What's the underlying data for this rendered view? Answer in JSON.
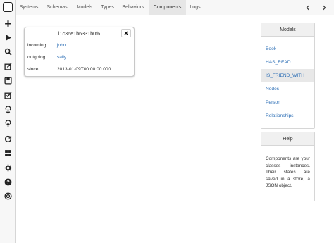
{
  "topnav": {
    "tabs": [
      {
        "label": "Systems",
        "active": false
      },
      {
        "label": "Schemas",
        "active": false
      },
      {
        "label": "Models",
        "active": false
      },
      {
        "label": "Types",
        "active": false
      },
      {
        "label": "Behaviors",
        "active": false
      },
      {
        "label": "Components",
        "active": true
      },
      {
        "label": "Logs",
        "active": false
      }
    ],
    "prev_icon": "chevron-left-icon",
    "next_icon": "chevron-right-icon"
  },
  "leftbar": {
    "icons": [
      "plus-icon",
      "play-icon",
      "search-icon",
      "edit-icon",
      "save-icon",
      "checklist-icon",
      "download-icon",
      "upload-icon",
      "refresh-icon",
      "grid-icon",
      "gear-icon",
      "help-icon",
      "info-icon"
    ]
  },
  "component": {
    "title": "i1c36e1b6331b0f6",
    "close_icon": "close-icon",
    "rows": [
      {
        "label": "incoming",
        "value": "john",
        "link": true
      },
      {
        "label": "outgoing",
        "value": "sally",
        "link": true
      },
      {
        "label": "since",
        "value": "2013-01-09T00:00:00.000 ...",
        "link": false
      }
    ]
  },
  "models_panel": {
    "title": "Models",
    "items": [
      {
        "label": "Book",
        "selected": false
      },
      {
        "label": "HAS_READ",
        "selected": false
      },
      {
        "label": "IS_FRIEND_WITH",
        "selected": true
      },
      {
        "label": "Nodes",
        "selected": false
      },
      {
        "label": "Person",
        "selected": false
      },
      {
        "label": "Relationships",
        "selected": false
      }
    ]
  },
  "help_panel": {
    "title": "Help",
    "text": "Components are your classes instances. Their states are saved in a store, a JSON object."
  },
  "colors": {
    "link": "#2a6db5",
    "active_tab": "#e6e6e6",
    "bar_bg": "#f7f7f7"
  }
}
